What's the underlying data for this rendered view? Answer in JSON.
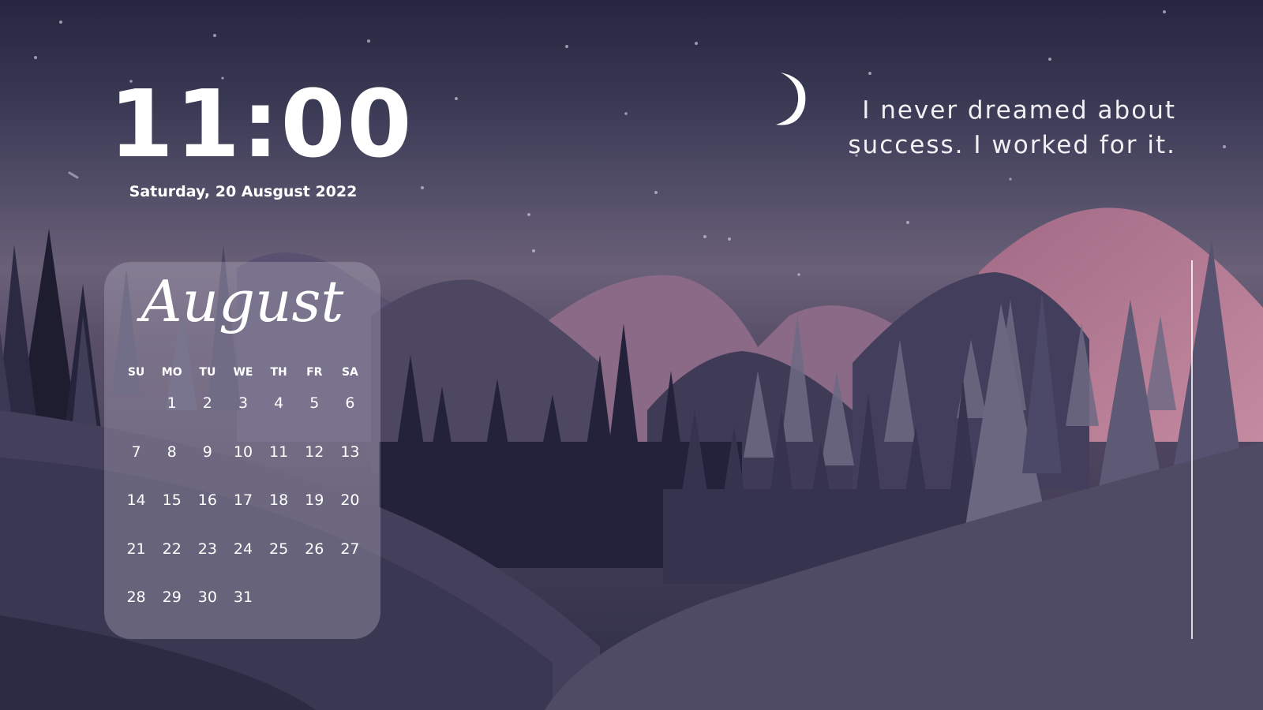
{
  "clock": {
    "time": "11:00",
    "date": "Saturday, 20 Ausgust 2022"
  },
  "quote": {
    "line1": "I never dreamed about",
    "line2": "success. I worked for it."
  },
  "calendar": {
    "month": "August",
    "weekdays": [
      "SU",
      "MO",
      "TU",
      "WE",
      "TH",
      "FR",
      "SA"
    ],
    "leading_blanks": 1,
    "days": [
      "1",
      "2",
      "3",
      "4",
      "5",
      "6",
      "7",
      "8",
      "9",
      "10",
      "11",
      "12",
      "13",
      "14",
      "15",
      "16",
      "17",
      "18",
      "19",
      "20",
      "21",
      "22",
      "23",
      "24",
      "25",
      "26",
      "27",
      "28",
      "29",
      "30",
      "31"
    ]
  },
  "colors": {
    "sky_top": "#262640",
    "sky_glow": "#6a6078",
    "mountain_pink": "#9c6a86",
    "mountain_mauve": "#6f5a76",
    "forest_dark": "#1f1f33",
    "text": "#ffffff"
  },
  "icons": {
    "moon": "crescent-moon-icon"
  }
}
